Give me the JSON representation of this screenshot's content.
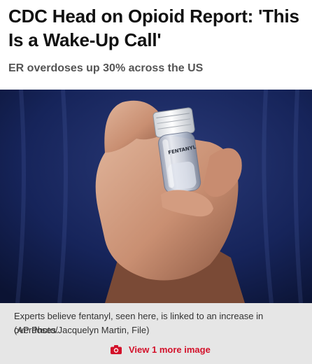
{
  "article": {
    "headline": "CDC Head on Opioid Report: 'This Is a Wake-Up Call'",
    "subheadline": "ER overdoses up 30% across the US",
    "photo": {
      "vial_label": "FENTANYL",
      "caption": "Experts believe fentanyl, seen here, is linked to an increase in overdoses.",
      "credit": "(AP Photo/Jacquelyn Martin, File)"
    },
    "gallery": {
      "view_more_label": "View 1 more image",
      "icon": "camera-icon",
      "accent_color": "#d3112a"
    }
  },
  "colors": {
    "photo_background": "#14204a",
    "caption_background": "#e6e6e6",
    "headline": "#111111",
    "subheadline": "#555555"
  }
}
